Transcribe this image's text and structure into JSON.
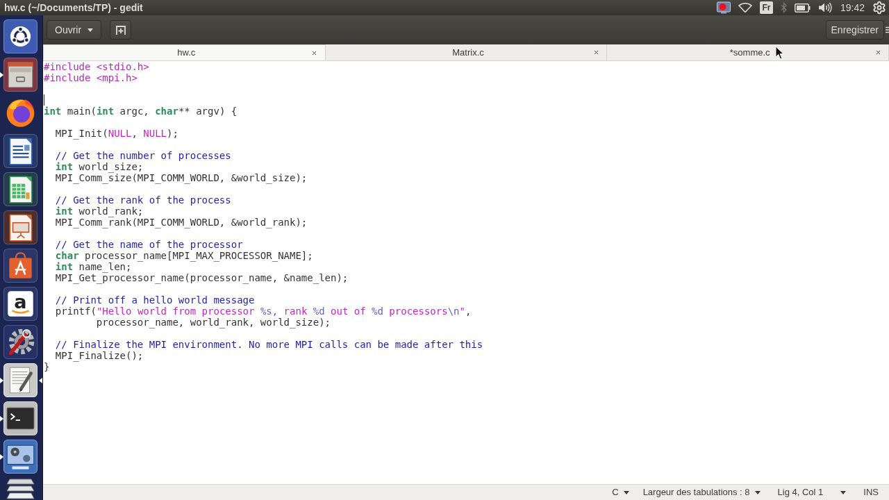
{
  "panel": {
    "title": "hw.c (~/Documents/TP) - gedit",
    "indicators": [
      {
        "kind": "recorder"
      },
      {
        "kind": "wifi"
      },
      {
        "kind": "keyboard",
        "label": "Fr"
      },
      {
        "kind": "bluetooth"
      },
      {
        "kind": "battery"
      },
      {
        "kind": "volume"
      },
      {
        "kind": "clock",
        "label": "19:42"
      },
      {
        "kind": "session"
      }
    ]
  },
  "launcher": [
    {
      "kind": "dash",
      "running": false,
      "focused": false
    },
    {
      "kind": "files",
      "running": true,
      "focused": false
    },
    {
      "kind": "browser",
      "running": false,
      "focused": false
    },
    {
      "kind": "writer",
      "running": false,
      "focused": false
    },
    {
      "kind": "calc",
      "running": false,
      "focused": false
    },
    {
      "kind": "impress",
      "running": false,
      "focused": false
    },
    {
      "kind": "store",
      "running": false,
      "focused": false
    },
    {
      "kind": "amazon",
      "glyph": "a",
      "running": false,
      "focused": false
    },
    {
      "kind": "settings",
      "running": false,
      "focused": false
    },
    {
      "kind": "editor",
      "running": true,
      "focused": true
    },
    {
      "kind": "terminal",
      "running": true,
      "focused": false
    },
    {
      "kind": "display",
      "running": true,
      "focused": false
    },
    {
      "kind": "trash",
      "running": false,
      "focused": false
    }
  ],
  "header": {
    "open_button": "Ouvrir",
    "save_button": "Enregistrer"
  },
  "tabs": [
    {
      "label": "hw.c",
      "selected": true
    },
    {
      "label": "Matrix.c",
      "selected": false
    },
    {
      "label": "*somme.c",
      "selected": false
    }
  ],
  "editor": {
    "lines": [
      {
        "caret": false,
        "tokens": [
          {
            "kind": "preproc",
            "text": "#include <stdio.h>"
          }
        ]
      },
      {
        "caret": false,
        "tokens": [
          {
            "kind": "preproc",
            "text": "#include <mpi.h>"
          }
        ]
      },
      {
        "caret": false
      },
      {
        "caret": true
      },
      {
        "caret": false,
        "tokens": [
          {
            "kind": "type",
            "text": "int"
          },
          {
            "kind": "plain",
            "text": " main("
          },
          {
            "kind": "type",
            "text": "int"
          },
          {
            "kind": "plain",
            "text": " argc, "
          },
          {
            "kind": "type",
            "text": "char"
          },
          {
            "kind": "plain",
            "text": "** argv) {"
          }
        ]
      },
      {
        "caret": false
      },
      {
        "caret": false,
        "tokens": [
          {
            "kind": "plain",
            "text": "  MPI_Init("
          },
          {
            "kind": "constant",
            "text": "NULL"
          },
          {
            "kind": "plain",
            "text": ", "
          },
          {
            "kind": "constant",
            "text": "NULL"
          },
          {
            "kind": "plain",
            "text": ");"
          }
        ]
      },
      {
        "caret": false
      },
      {
        "caret": false,
        "tokens": [
          {
            "kind": "comment",
            "text": "  // Get the number of processes"
          }
        ]
      },
      {
        "caret": false,
        "tokens": [
          {
            "kind": "type",
            "text": "  int"
          },
          {
            "kind": "plain",
            "text": " world_size;"
          }
        ]
      },
      {
        "caret": false,
        "tokens": [
          {
            "kind": "plain",
            "text": "  MPI_Comm_size(MPI_COMM_WORLD, &world_size);"
          }
        ]
      },
      {
        "caret": false
      },
      {
        "caret": false,
        "tokens": [
          {
            "kind": "comment",
            "text": "  // Get the rank of the process"
          }
        ]
      },
      {
        "caret": false,
        "tokens": [
          {
            "kind": "type",
            "text": "  int"
          },
          {
            "kind": "plain",
            "text": " world_rank;"
          }
        ]
      },
      {
        "caret": false,
        "tokens": [
          {
            "kind": "plain",
            "text": "  MPI_Comm_rank(MPI_COMM_WORLD, &world_rank);"
          }
        ]
      },
      {
        "caret": false
      },
      {
        "caret": false,
        "tokens": [
          {
            "kind": "comment",
            "text": "  // Get the name of the processor"
          }
        ]
      },
      {
        "caret": false,
        "tokens": [
          {
            "kind": "type",
            "text": "  char"
          },
          {
            "kind": "plain",
            "text": " processor_name[MPI_MAX_PROCESSOR_NAME];"
          }
        ]
      },
      {
        "caret": false,
        "tokens": [
          {
            "kind": "type",
            "text": "  int"
          },
          {
            "kind": "plain",
            "text": " name_len;"
          }
        ]
      },
      {
        "caret": false,
        "tokens": [
          {
            "kind": "plain",
            "text": "  MPI_Get_processor_name(processor_name, &name_len);"
          }
        ]
      },
      {
        "caret": false
      },
      {
        "caret": false,
        "tokens": [
          {
            "kind": "comment",
            "text": "  // Print off a hello world message"
          }
        ]
      },
      {
        "caret": false,
        "tokens": [
          {
            "kind": "plain",
            "text": "  printf("
          },
          {
            "kind": "string",
            "text": "\"Hello world from processor "
          },
          {
            "kind": "format",
            "text": "%s"
          },
          {
            "kind": "string",
            "text": ", rank "
          },
          {
            "kind": "format",
            "text": "%d"
          },
          {
            "kind": "string",
            "text": " out of "
          },
          {
            "kind": "format",
            "text": "%d"
          },
          {
            "kind": "string",
            "text": " processors"
          },
          {
            "kind": "format",
            "text": "\\n"
          },
          {
            "kind": "string",
            "text": "\""
          },
          {
            "kind": "plain",
            "text": ","
          }
        ]
      },
      {
        "caret": false,
        "tokens": [
          {
            "kind": "plain",
            "text": "         processor_name, world_rank, world_size);"
          }
        ]
      },
      {
        "caret": false
      },
      {
        "caret": false,
        "tokens": [
          {
            "kind": "comment",
            "text": "  // Finalize the MPI environment. No more MPI calls can be made after this"
          }
        ]
      },
      {
        "caret": false,
        "tokens": [
          {
            "kind": "plain",
            "text": "  MPI_Finalize();"
          }
        ]
      },
      {
        "caret": false,
        "tokens": [
          {
            "kind": "plain",
            "text": "}"
          }
        ]
      }
    ]
  },
  "status_bar": [
    {
      "kind": "dropdown",
      "label": "C"
    },
    {
      "kind": "dropdown",
      "label": "Largeur des tabulations : 8"
    },
    {
      "kind": "text",
      "label": "Lig 4, Col 1"
    },
    {
      "kind": "dropdown"
    },
    {
      "kind": "text",
      "label": "INS"
    }
  ]
}
